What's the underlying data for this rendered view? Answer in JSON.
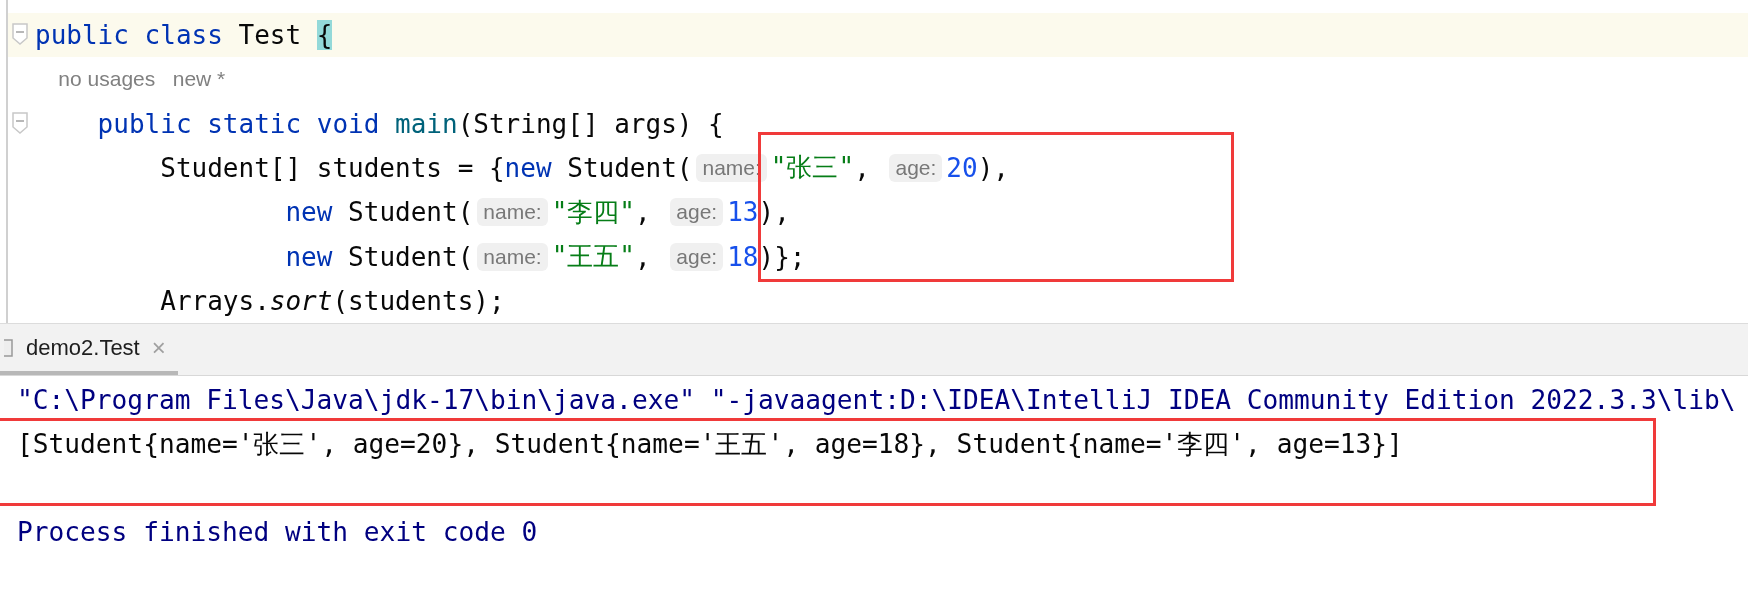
{
  "editor": {
    "lines": [
      {
        "current": true,
        "fold": true,
        "tokens": [
          {
            "kind": "keyword",
            "text": "public class "
          },
          {
            "kind": "plain",
            "text": "Test "
          },
          {
            "kind": "brace_match",
            "text": "{"
          }
        ]
      },
      {
        "current": false,
        "fold": false,
        "tokens": [
          {
            "kind": "lens",
            "text": "    no usages   new *"
          }
        ]
      },
      {
        "current": false,
        "fold": true,
        "tokens": [
          {
            "kind": "keyword",
            "text": "    public static void "
          },
          {
            "kind": "method",
            "text": "main"
          },
          {
            "kind": "plain",
            "text": "(String[] args) {"
          }
        ]
      },
      {
        "current": false,
        "fold": false,
        "tokens": [
          {
            "kind": "plain",
            "text": "        Student[] students = {"
          },
          {
            "kind": "keyword",
            "text": "new "
          },
          {
            "kind": "plain",
            "text": "Student("
          },
          {
            "kind": "hint",
            "text": "name:"
          },
          {
            "kind": "string",
            "text": "\"张三\""
          },
          {
            "kind": "plain",
            "text": ", "
          },
          {
            "kind": "hint",
            "text": "age:"
          },
          {
            "kind": "number",
            "text": "20"
          },
          {
            "kind": "plain",
            "text": "),"
          }
        ]
      },
      {
        "current": false,
        "fold": false,
        "tokens": [
          {
            "kind": "keyword",
            "text": "                new "
          },
          {
            "kind": "plain",
            "text": "Student("
          },
          {
            "kind": "hint",
            "text": "name:"
          },
          {
            "kind": "string",
            "text": "\"李四\""
          },
          {
            "kind": "plain",
            "text": ", "
          },
          {
            "kind": "hint",
            "text": "age:"
          },
          {
            "kind": "number",
            "text": "13"
          },
          {
            "kind": "plain",
            "text": "),"
          }
        ]
      },
      {
        "current": false,
        "fold": false,
        "tokens": [
          {
            "kind": "keyword",
            "text": "                new "
          },
          {
            "kind": "plain",
            "text": "Student("
          },
          {
            "kind": "hint",
            "text": "name:"
          },
          {
            "kind": "string",
            "text": "\"王五\""
          },
          {
            "kind": "plain",
            "text": ", "
          },
          {
            "kind": "hint",
            "text": "age:"
          },
          {
            "kind": "number",
            "text": "18"
          },
          {
            "kind": "plain",
            "text": ")};"
          }
        ]
      },
      {
        "current": false,
        "fold": false,
        "tokens": [
          {
            "kind": "plain",
            "text": "        Arrays."
          },
          {
            "kind": "static",
            "text": "sort"
          },
          {
            "kind": "plain",
            "text": "(students);"
          }
        ]
      }
    ]
  },
  "run_tabs": [
    {
      "label": "demo2.Test",
      "selected": true,
      "close": "×"
    }
  ],
  "console": {
    "lines": [
      {
        "kind": "system",
        "text": "\"C:\\Program Files\\Java\\jdk-17\\bin\\java.exe\" \"-javaagent:D:\\IDEA\\IntelliJ IDEA Community Edition 2022.3.3\\lib\\"
      },
      {
        "kind": "output",
        "text": "[Student{name='张三', age=20}, Student{name='王五', age=18}, Student{name='李四', age=13}]"
      },
      {
        "kind": "blank"
      },
      {
        "kind": "system",
        "text": "Process finished with exit code 0"
      }
    ]
  }
}
